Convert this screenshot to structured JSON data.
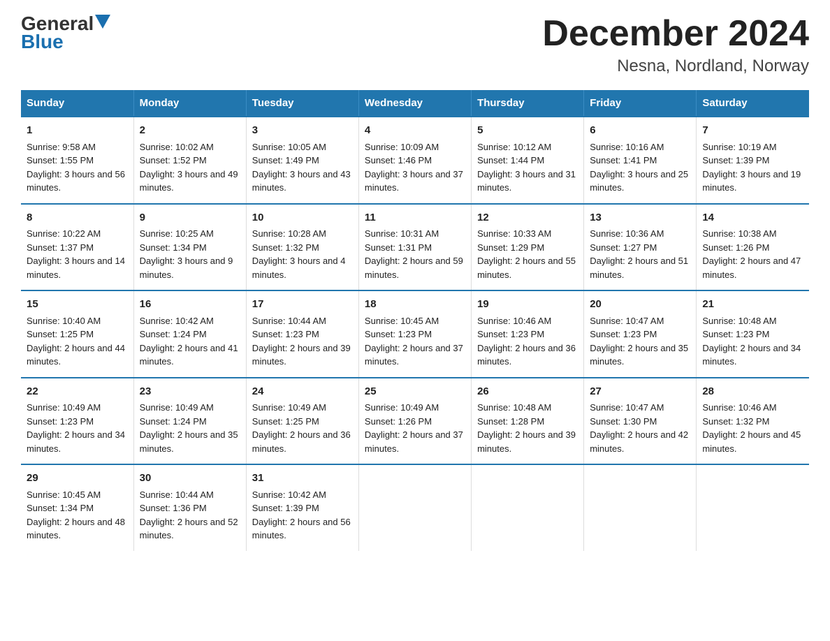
{
  "header": {
    "logo_general": "General",
    "logo_blue": "Blue",
    "title": "December 2024",
    "subtitle": "Nesna, Nordland, Norway"
  },
  "days_of_week": [
    "Sunday",
    "Monday",
    "Tuesday",
    "Wednesday",
    "Thursday",
    "Friday",
    "Saturday"
  ],
  "weeks": [
    [
      {
        "day": "1",
        "sunrise": "9:58 AM",
        "sunset": "1:55 PM",
        "daylight": "3 hours and 56 minutes."
      },
      {
        "day": "2",
        "sunrise": "10:02 AM",
        "sunset": "1:52 PM",
        "daylight": "3 hours and 49 minutes."
      },
      {
        "day": "3",
        "sunrise": "10:05 AM",
        "sunset": "1:49 PM",
        "daylight": "3 hours and 43 minutes."
      },
      {
        "day": "4",
        "sunrise": "10:09 AM",
        "sunset": "1:46 PM",
        "daylight": "3 hours and 37 minutes."
      },
      {
        "day": "5",
        "sunrise": "10:12 AM",
        "sunset": "1:44 PM",
        "daylight": "3 hours and 31 minutes."
      },
      {
        "day": "6",
        "sunrise": "10:16 AM",
        "sunset": "1:41 PM",
        "daylight": "3 hours and 25 minutes."
      },
      {
        "day": "7",
        "sunrise": "10:19 AM",
        "sunset": "1:39 PM",
        "daylight": "3 hours and 19 minutes."
      }
    ],
    [
      {
        "day": "8",
        "sunrise": "10:22 AM",
        "sunset": "1:37 PM",
        "daylight": "3 hours and 14 minutes."
      },
      {
        "day": "9",
        "sunrise": "10:25 AM",
        "sunset": "1:34 PM",
        "daylight": "3 hours and 9 minutes."
      },
      {
        "day": "10",
        "sunrise": "10:28 AM",
        "sunset": "1:32 PM",
        "daylight": "3 hours and 4 minutes."
      },
      {
        "day": "11",
        "sunrise": "10:31 AM",
        "sunset": "1:31 PM",
        "daylight": "2 hours and 59 minutes."
      },
      {
        "day": "12",
        "sunrise": "10:33 AM",
        "sunset": "1:29 PM",
        "daylight": "2 hours and 55 minutes."
      },
      {
        "day": "13",
        "sunrise": "10:36 AM",
        "sunset": "1:27 PM",
        "daylight": "2 hours and 51 minutes."
      },
      {
        "day": "14",
        "sunrise": "10:38 AM",
        "sunset": "1:26 PM",
        "daylight": "2 hours and 47 minutes."
      }
    ],
    [
      {
        "day": "15",
        "sunrise": "10:40 AM",
        "sunset": "1:25 PM",
        "daylight": "2 hours and 44 minutes."
      },
      {
        "day": "16",
        "sunrise": "10:42 AM",
        "sunset": "1:24 PM",
        "daylight": "2 hours and 41 minutes."
      },
      {
        "day": "17",
        "sunrise": "10:44 AM",
        "sunset": "1:23 PM",
        "daylight": "2 hours and 39 minutes."
      },
      {
        "day": "18",
        "sunrise": "10:45 AM",
        "sunset": "1:23 PM",
        "daylight": "2 hours and 37 minutes."
      },
      {
        "day": "19",
        "sunrise": "10:46 AM",
        "sunset": "1:23 PM",
        "daylight": "2 hours and 36 minutes."
      },
      {
        "day": "20",
        "sunrise": "10:47 AM",
        "sunset": "1:23 PM",
        "daylight": "2 hours and 35 minutes."
      },
      {
        "day": "21",
        "sunrise": "10:48 AM",
        "sunset": "1:23 PM",
        "daylight": "2 hours and 34 minutes."
      }
    ],
    [
      {
        "day": "22",
        "sunrise": "10:49 AM",
        "sunset": "1:23 PM",
        "daylight": "2 hours and 34 minutes."
      },
      {
        "day": "23",
        "sunrise": "10:49 AM",
        "sunset": "1:24 PM",
        "daylight": "2 hours and 35 minutes."
      },
      {
        "day": "24",
        "sunrise": "10:49 AM",
        "sunset": "1:25 PM",
        "daylight": "2 hours and 36 minutes."
      },
      {
        "day": "25",
        "sunrise": "10:49 AM",
        "sunset": "1:26 PM",
        "daylight": "2 hours and 37 minutes."
      },
      {
        "day": "26",
        "sunrise": "10:48 AM",
        "sunset": "1:28 PM",
        "daylight": "2 hours and 39 minutes."
      },
      {
        "day": "27",
        "sunrise": "10:47 AM",
        "sunset": "1:30 PM",
        "daylight": "2 hours and 42 minutes."
      },
      {
        "day": "28",
        "sunrise": "10:46 AM",
        "sunset": "1:32 PM",
        "daylight": "2 hours and 45 minutes."
      }
    ],
    [
      {
        "day": "29",
        "sunrise": "10:45 AM",
        "sunset": "1:34 PM",
        "daylight": "2 hours and 48 minutes."
      },
      {
        "day": "30",
        "sunrise": "10:44 AM",
        "sunset": "1:36 PM",
        "daylight": "2 hours and 52 minutes."
      },
      {
        "day": "31",
        "sunrise": "10:42 AM",
        "sunset": "1:39 PM",
        "daylight": "2 hours and 56 minutes."
      },
      null,
      null,
      null,
      null
    ]
  ],
  "labels": {
    "sunrise": "Sunrise:",
    "sunset": "Sunset:",
    "daylight": "Daylight:"
  },
  "accent_color": "#2176ae"
}
